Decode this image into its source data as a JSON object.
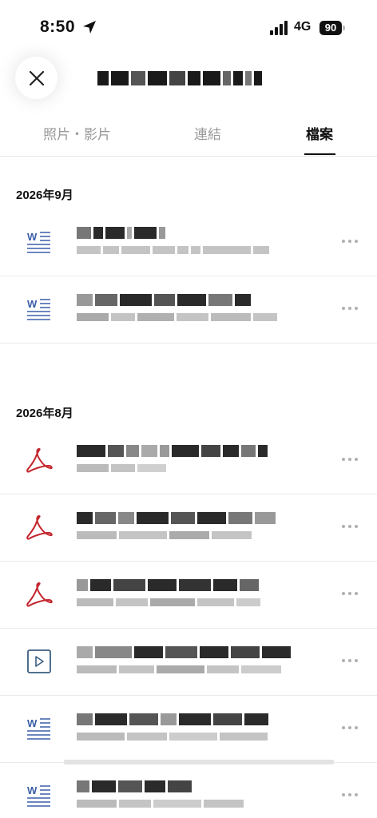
{
  "status_bar": {
    "time": "8:50",
    "network": "4G",
    "battery_level": "90"
  },
  "tabs": [
    {
      "label": "照片・影片",
      "active": false
    },
    {
      "label": "連結",
      "active": false
    },
    {
      "label": "檔案",
      "active": true
    }
  ],
  "sections": [
    {
      "label": "2026年9月",
      "files": [
        {
          "type": "word-icon"
        },
        {
          "type": "word-icon"
        }
      ]
    },
    {
      "label": "2026年8月",
      "files": [
        {
          "type": "pdf-icon"
        },
        {
          "type": "pdf-icon"
        },
        {
          "type": "pdf-icon"
        },
        {
          "type": "video-icon"
        },
        {
          "type": "word-icon"
        },
        {
          "type": "word-icon"
        }
      ]
    }
  ],
  "colors": {
    "word_icon": "#3b5ea8",
    "pdf_icon": "#c4262e",
    "video_icon": "#3b5e80",
    "tab_active": "#111111",
    "tab_inactive": "#9a9a9a"
  }
}
